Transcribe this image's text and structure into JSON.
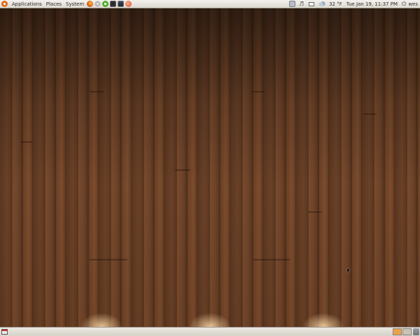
{
  "top_panel": {
    "menus": {
      "applications": "Applications",
      "places": "Places",
      "system": "System"
    },
    "launchers": [
      "firefox-icon",
      "system-settings-icon",
      "chat-icon",
      "terminal-icon",
      "system-monitor-icon",
      "update-notifier-icon"
    ],
    "tray": {
      "weather": "32 °F",
      "clock": "Tue Jan 19, 11:37 PM",
      "user": "wes"
    }
  },
  "bottom_panel": {
    "workspaces": 2,
    "active_workspace": 1
  },
  "colors": {
    "panel": "#dcd8cf",
    "accent": "#e9a24c",
    "ubuntu_orange": "#e16a1b"
  }
}
